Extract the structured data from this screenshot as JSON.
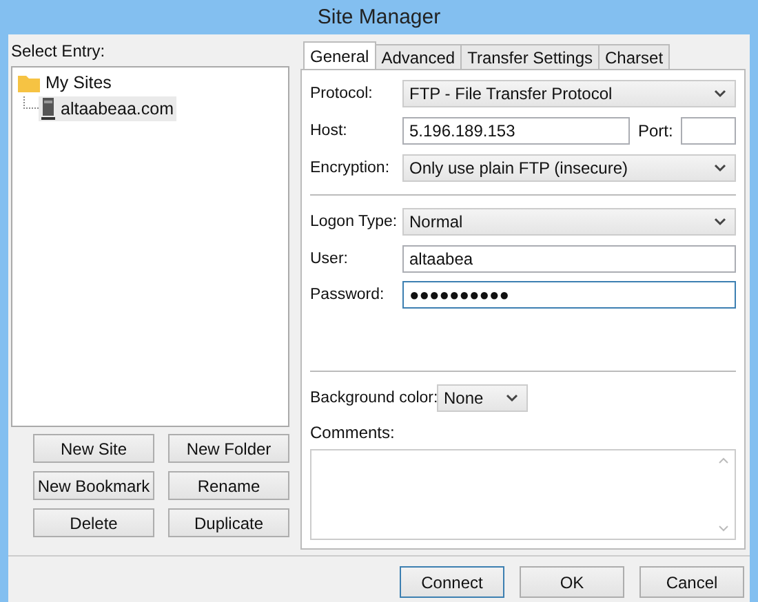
{
  "window": {
    "title": "Site Manager"
  },
  "select_entry_label": "Select Entry:",
  "tree": [
    {
      "label": "My Sites",
      "kind": "folder",
      "selected": false,
      "children": [
        {
          "label": "altaabeaa.com",
          "kind": "site",
          "selected": true
        }
      ]
    }
  ],
  "site_buttons": [
    "New Site",
    "New Folder",
    "New Bookmark",
    "Rename",
    "Delete",
    "Duplicate"
  ],
  "tabs": [
    {
      "label": "General",
      "selected": true
    },
    {
      "label": "Advanced",
      "selected": false
    },
    {
      "label": "Transfer Settings",
      "selected": false
    },
    {
      "label": "Charset",
      "selected": false
    }
  ],
  "protocol": {
    "label": "Protocol:",
    "value": "FTP - File Transfer Protocol"
  },
  "host": {
    "label": "Host:",
    "value": "5.196.189.153"
  },
  "port": {
    "label": "Port:"
  },
  "encryption": {
    "label": "Encryption:",
    "value": "Only use plain FTP (insecure)"
  },
  "logon_type": {
    "label": "Logon Type:",
    "value": "Normal"
  },
  "user": {
    "label": "User:",
    "value": "altaabea"
  },
  "password": {
    "label": "Password:",
    "value": "●●●●●●●●●●"
  },
  "background_color": {
    "label": "Background color:",
    "value": "None"
  },
  "comments": {
    "label": "Comments:"
  },
  "buttons": [
    "Connect",
    "OK",
    "Cancel"
  ]
}
